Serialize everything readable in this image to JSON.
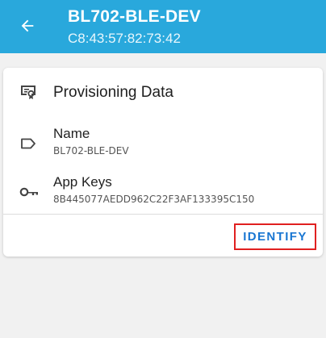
{
  "appbar": {
    "title": "BL702-BLE-DEV",
    "subtitle": "C8:43:57:82:73:42",
    "back_icon": "arrow-left-icon"
  },
  "card": {
    "title": "Provisioning Data",
    "title_icon": "certificate-icon",
    "rows": [
      {
        "label": "Name",
        "value": "BL702-BLE-DEV",
        "icon": "label-tag-icon"
      },
      {
        "label": "App Keys",
        "value": "8B445077AEDD962C22F3AF133395C150",
        "icon": "key-icon"
      }
    ],
    "action_label": "IDENTIFY"
  },
  "colors": {
    "appbar": "#29a8dc",
    "accent": "#1976d2",
    "highlight_border": "#e02020",
    "background": "#f1f1f1"
  }
}
